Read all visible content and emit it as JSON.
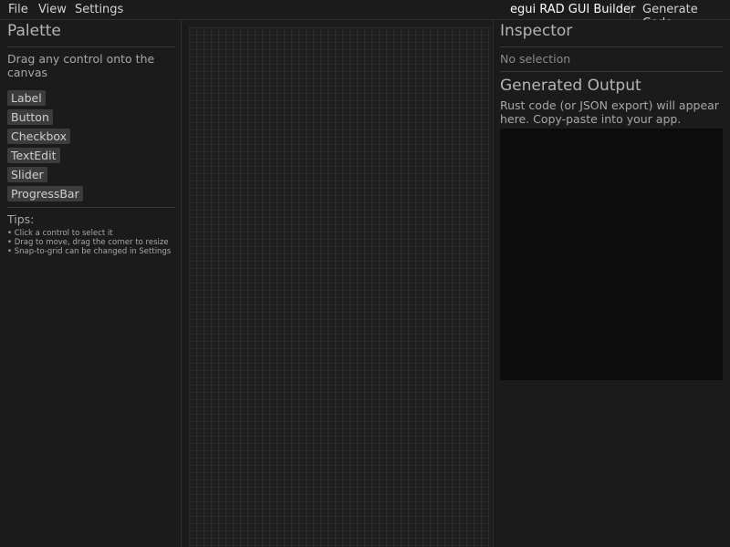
{
  "menubar": {
    "items": [
      "File",
      "View",
      "Settings"
    ],
    "app_title": "egui RAD GUI Builder",
    "generate_label": "Generate Code"
  },
  "palette": {
    "title": "Palette",
    "hint_line1": "Drag any control onto the",
    "hint_line2": "canvas",
    "controls": [
      "Label",
      "Button",
      "Checkbox",
      "TextEdit",
      "Slider",
      "ProgressBar"
    ],
    "tips_title": "Tips:",
    "tips": [
      "• Click a control to select it",
      "• Drag to move, drag the corner to resize",
      "• Snap-to-grid can be changed in Settings"
    ]
  },
  "inspector": {
    "title": "Inspector",
    "empty_text": "No selection"
  },
  "output": {
    "title": "Generated Output",
    "desc_line1": "Rust code (or JSON export) will appear",
    "desc_line2": "here. Copy-paste into your app.",
    "code": ""
  },
  "colors": {
    "background": "#1b1b1b",
    "button_bg": "#3c3c3c",
    "output_bg": "#0c0c0c",
    "grid": "#2a2a2a"
  }
}
